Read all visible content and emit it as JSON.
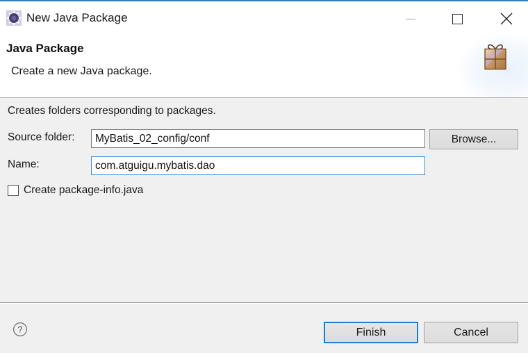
{
  "window": {
    "title": "New Java Package",
    "app_icon": "java-package-gear-icon",
    "controls": {
      "minimize_label": "Minimize",
      "maximize_label": "Maximize",
      "close_label": "Close"
    }
  },
  "header": {
    "title": "Java Package",
    "subtitle": "Create a new Java package.",
    "banner_icon": "gift-box-icon"
  },
  "body": {
    "hint": "Creates folders corresponding to packages.",
    "fields": [
      {
        "label": "Source folder:",
        "value": "MyBatis_02_config/conf",
        "placeholder": "",
        "focused": false,
        "button_label": "Browse..."
      },
      {
        "label": "Name:",
        "value": "com.atguigu.mybatis.dao",
        "placeholder": "",
        "focused": true,
        "button_label": ""
      }
    ],
    "checkbox": {
      "label": "Create package-info.java",
      "checked": false
    }
  },
  "footer": {
    "help_icon": "help-question-icon",
    "finish_label": "Finish",
    "cancel_label": "Cancel"
  },
  "colors": {
    "accent_blue": "#1a7fd4",
    "focus_border": "#3a8fd0",
    "titlebar_top_border": "#3a7cb8",
    "body_background": "#f0f0f0",
    "gift_brown": "#b07f4e"
  }
}
